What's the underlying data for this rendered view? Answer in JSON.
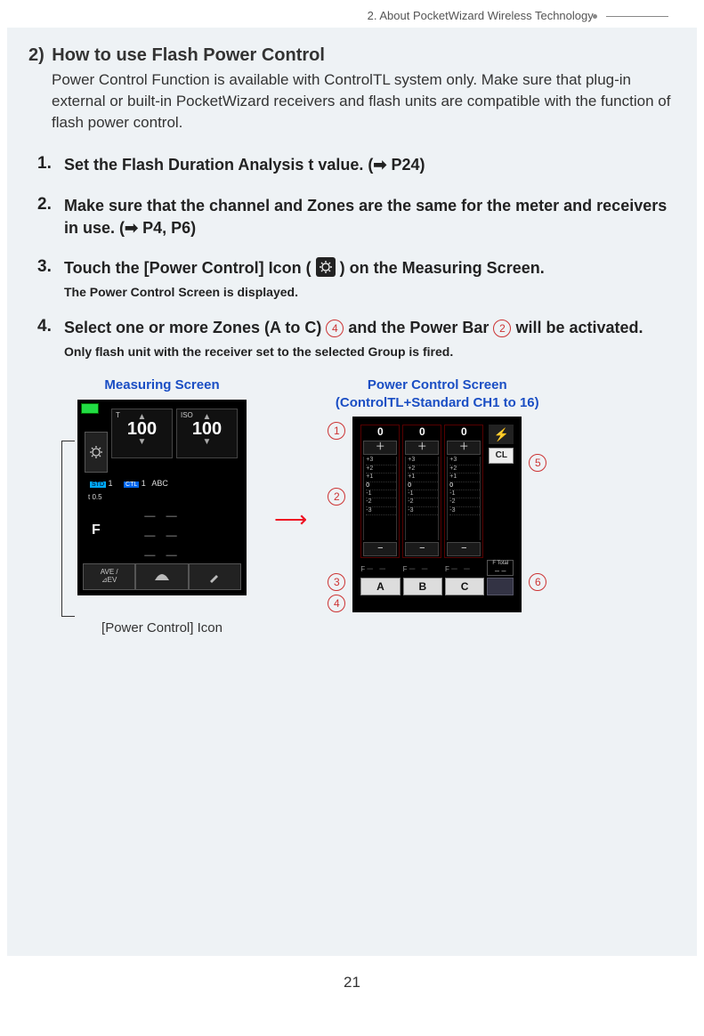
{
  "header": {
    "chapter": "2.  About PocketWizard Wireless Technology"
  },
  "section": {
    "number": "2)",
    "title": "How to use Flash Power Control",
    "desc": "Power Control Function is available with ControlTL system only. Make sure that plug-in external or built-in PocketWizard receivers and flash units are compatible with the function of flash power control."
  },
  "steps": {
    "s1": "Set the Flash Duration Analysis t value. (➡  P24)",
    "s2": "Make sure that the channel and Zones are the same for the meter and receivers in use. (➡  P4, P6)",
    "s3_a": "Touch the [Power Control] Icon ( ",
    "s3_b": " ) on the Measuring Screen.",
    "s3_sub": "The Power Control Screen is displayed.",
    "s4_a": "Select one or more Zones (A to C) ",
    "s4_b": " and the Power Bar ",
    "s4_c": " will be activated.",
    "s4_sub": "Only flash unit with the receiver set to the selected Group is fired."
  },
  "screens": {
    "measuring_label": "Measuring Screen",
    "power_label_l1": "Power Control Screen",
    "power_label_l2": "(ControlTL+Standard CH1 to 16)",
    "icon_caption": "[Power Control] Icon"
  },
  "measuring": {
    "t_label": "T",
    "t_value": "100",
    "iso_label": "ISO",
    "iso_value": "100",
    "std": "STD",
    "t05": "t 0.5",
    "ctl": "CTL",
    "one": "1",
    "abc": "ABC",
    "f": "F",
    "ave": "AVE /",
    "ev": "⊿EV"
  },
  "power": {
    "zone_val": "0",
    "plus": "＋",
    "minus": "−",
    "scale": [
      "+3",
      "+2",
      "+1",
      "0",
      "-1",
      "-2",
      "-3"
    ],
    "cl": "CL",
    "f": "F",
    "ftotal": "F Total",
    "zones": {
      "a": "A",
      "b": "B",
      "c": "C"
    }
  },
  "callouts": {
    "c1": "1",
    "c2": "2",
    "c3": "3",
    "c4": "4",
    "c5": "5",
    "c6": "6"
  },
  "inline_callouts": {
    "c4": "4",
    "c2": "2"
  },
  "page_number": "21"
}
